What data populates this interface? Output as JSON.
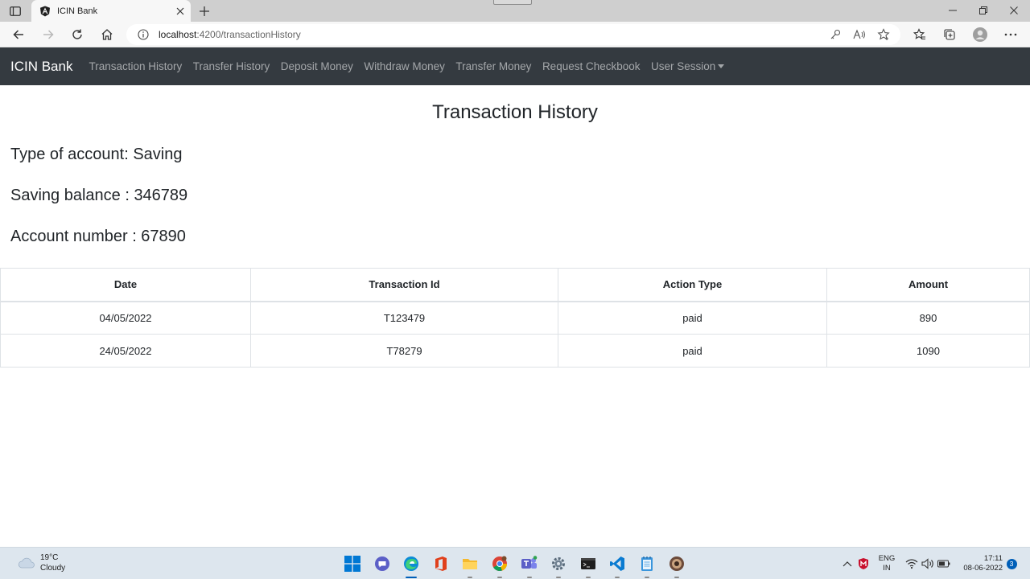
{
  "browser": {
    "tab_title": "ICIN Bank",
    "url_host": "localhost",
    "url_path": ":4200/transactionHistory"
  },
  "navbar": {
    "brand": "ICIN Bank",
    "links": [
      "Transaction History",
      "Transfer History",
      "Deposit Money",
      "Withdraw Money",
      "Transfer Money",
      "Request Checkbook",
      "User Session"
    ]
  },
  "page": {
    "title": "Transaction History",
    "account_type": "Type of account: Saving",
    "balance": "Saving balance : 346789",
    "account_number": "Account number : 67890"
  },
  "table": {
    "headers": [
      "Date",
      "Transaction Id",
      "Action Type",
      "Amount"
    ],
    "rows": [
      [
        "04/05/2022",
        "T123479",
        "paid",
        "890"
      ],
      [
        "24/05/2022",
        "T78279",
        "paid",
        "1090"
      ]
    ]
  },
  "taskbar": {
    "temperature": "19°C",
    "weather": "Cloudy",
    "lang_top": "ENG",
    "lang_bottom": "IN",
    "time": "17:11",
    "date": "08-06-2022",
    "notifications": "3",
    "apps": [
      "windows-start",
      "teams-chat",
      "edge",
      "office",
      "file-explorer",
      "chrome",
      "teams",
      "settings",
      "terminal",
      "vscode",
      "notepad",
      "app-icon"
    ]
  },
  "colors": {
    "navbar_bg": "#343a40",
    "taskbar_bg": "#dde6ee",
    "accent": "#005fb8"
  }
}
